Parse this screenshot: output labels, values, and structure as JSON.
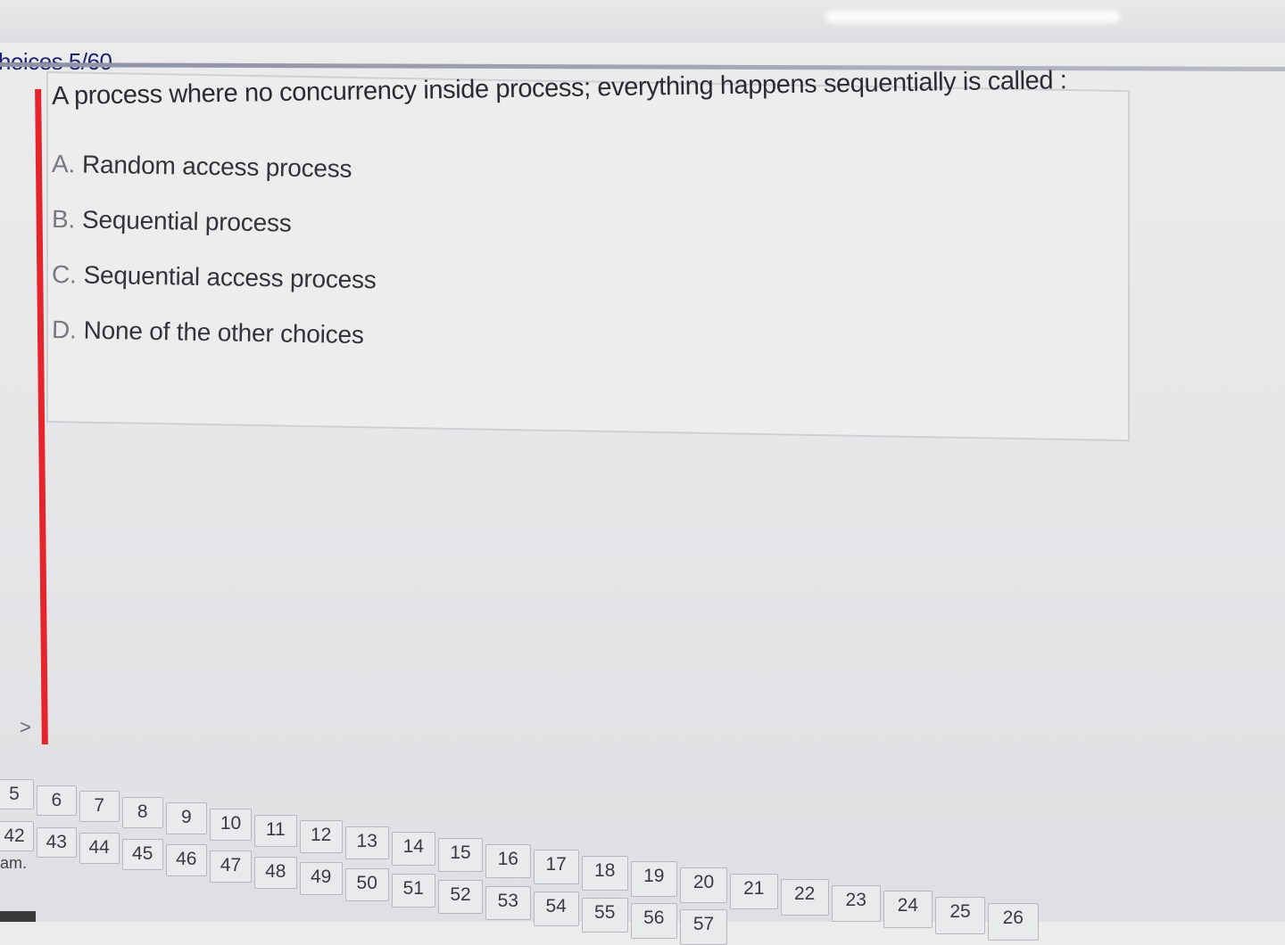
{
  "header": {
    "section_label": "hoices 5/60"
  },
  "question": {
    "text": "A process where no concurrency inside process; everything happens sequentially is called :",
    "options": [
      {
        "letter": "A.",
        "text": "Random access process"
      },
      {
        "letter": "B.",
        "text": "Sequential process"
      },
      {
        "letter": "C.",
        "text": "Sequential access process"
      },
      {
        "letter": "D.",
        "text": "None of the other choices"
      }
    ]
  },
  "navigation": {
    "chevron": ">",
    "row1": [
      "5",
      "6",
      "7",
      "8",
      "9",
      "10",
      "11",
      "12",
      "13",
      "14",
      "15",
      "16",
      "17",
      "18",
      "19",
      "20",
      "21",
      "22",
      "23",
      "24",
      "25",
      "26"
    ],
    "row2": [
      "42",
      "43",
      "44",
      "45",
      "46",
      "47",
      "48",
      "49",
      "50",
      "51",
      "52",
      "53",
      "54",
      "55",
      "56",
      "57"
    ],
    "note": "am."
  },
  "colors": {
    "accent_rule": "#e5252b",
    "title": "#1f2270"
  }
}
